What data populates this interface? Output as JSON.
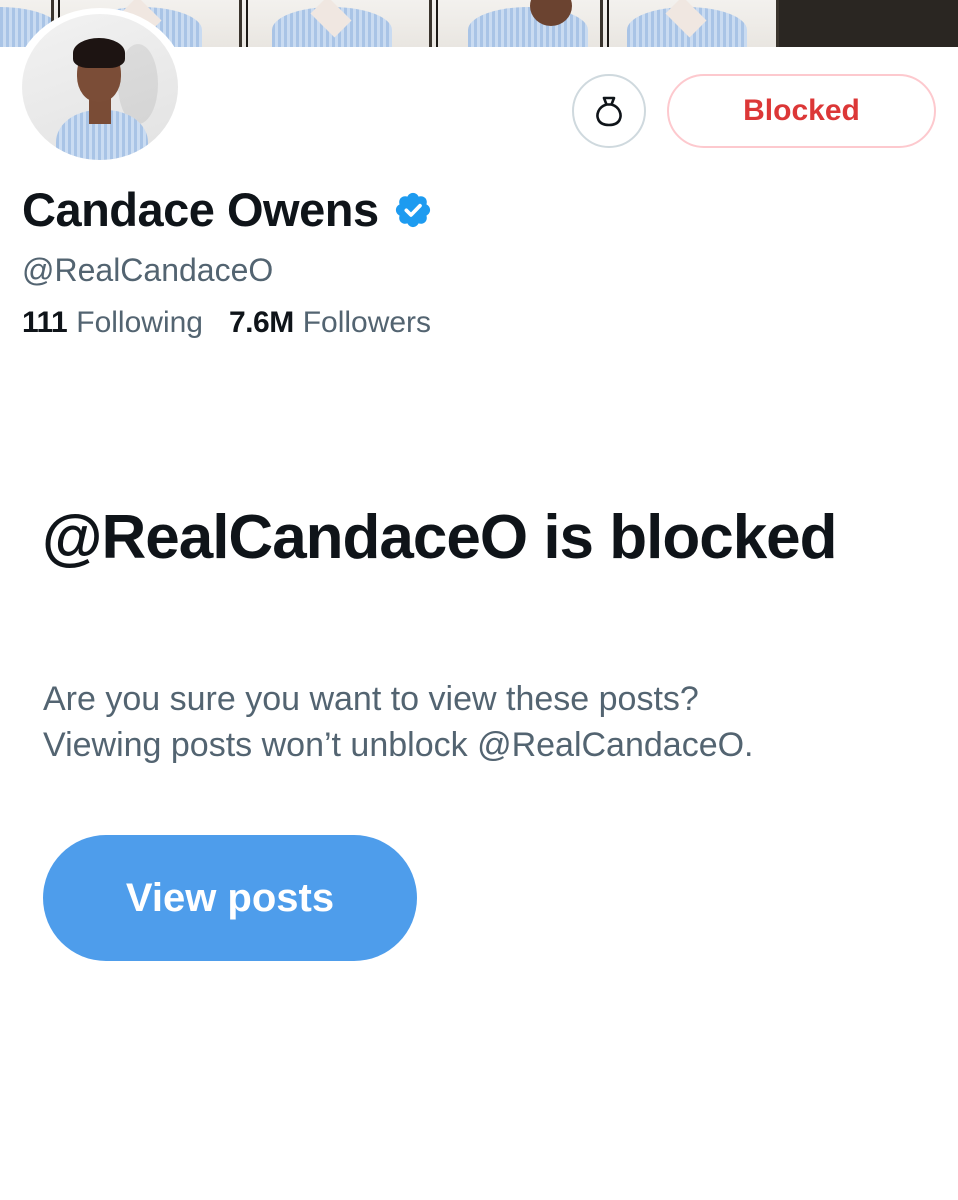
{
  "profile": {
    "display_name": "Candace Owens",
    "handle": "@RealCandaceO",
    "following_count": "111",
    "following_label": "Following",
    "followers_count": "7.6M",
    "followers_label": "Followers"
  },
  "actions": {
    "gift_icon": "money-bag-icon",
    "blocked_label": "Blocked"
  },
  "blocked_notice": {
    "title": "@RealCandaceO is blocked",
    "message_line_1": "Are you sure you want to view these posts?",
    "message_line_2": "Viewing posts won’t unblock @RealCandaceO.",
    "view_posts_label": "View posts"
  },
  "colors": {
    "verified_blue": "#1d9bf0",
    "blocked_red": "#dc3737",
    "blocked_border": "#fdc9ce",
    "primary_button": "#4e9deb",
    "text_primary": "#0f1419",
    "text_secondary": "#536471"
  }
}
